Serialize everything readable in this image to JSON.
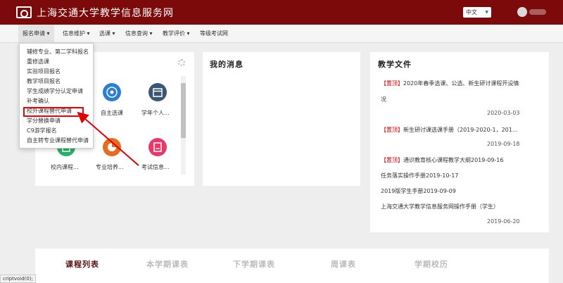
{
  "header": {
    "site_title": "上海交通大学教学信息服务网",
    "language": "中文",
    "language_icon": "chevron-down-icon",
    "brand_color": "#7d0a0a"
  },
  "nav": {
    "items": [
      {
        "label": "报名申请 ▾"
      },
      {
        "label": "信息维护 ▾"
      },
      {
        "label": "选课 ▾"
      },
      {
        "label": "信息查询 ▾"
      },
      {
        "label": "教学评价 ▾"
      },
      {
        "label": "等级考试网"
      }
    ]
  },
  "dropdown": {
    "items": [
      {
        "label": "辅修专业、第二学科报名"
      },
      {
        "label": "重修选课"
      },
      {
        "label": "实验项目报名"
      },
      {
        "label": "教学项目报名"
      },
      {
        "label": "学生成绩学分认定申请"
      },
      {
        "label": "补考确认"
      },
      {
        "label": "校外课程替代申请"
      },
      {
        "label": "学分替换申请"
      },
      {
        "label": "C9游学报名"
      },
      {
        "label": "自主转专业课程替代申请"
      }
    ],
    "highlighted_index": 6,
    "highlight_color": "#e00000"
  },
  "apps": {
    "items": [
      {
        "label": "自主选课",
        "icon": "soccer-ball-icon",
        "color": "#2a7fd4"
      },
      {
        "label": "学年个人...",
        "icon": "calendar-icon",
        "color": "#3a5672"
      },
      {
        "label": "校内课程...",
        "icon": "document-icon",
        "color": "#27b36a"
      },
      {
        "label": "专业培养...",
        "icon": "chart-icon",
        "color": "#e66d1f"
      },
      {
        "label": "考试信息...",
        "icon": "file-icon",
        "color": "#e83a6a"
      }
    ]
  },
  "messages": {
    "title": "我的消息"
  },
  "documents": {
    "title": "教学文件",
    "items": [
      {
        "tag": "【置顶】",
        "text": "2020年春季选课、公选、新生研讨课程开设情",
        "text2": "况",
        "date": "2020-03-03"
      },
      {
        "tag": "【置顶】",
        "text": "新生研讨课选课手册（2019-2020-1，201...",
        "date": "2019-09-18"
      },
      {
        "tag": "【置顶】",
        "text": "通识教育核心课程教学大纲2019-09-16",
        "date": ""
      },
      {
        "tag": "",
        "text": "任务落实操作手册2019-10-17",
        "date": ""
      },
      {
        "tag": "",
        "text": "2019版学生手册2019-09-09",
        "date": ""
      },
      {
        "tag": "",
        "text": "上海交通大学教学信息服务网操作手册（学生）",
        "date": "2019-06-20"
      }
    ]
  },
  "tabs": {
    "items": [
      {
        "label": "课程列表"
      },
      {
        "label": "本学期课表"
      },
      {
        "label": "下学期课表"
      },
      {
        "label": "周课表"
      },
      {
        "label": "学期校历"
      }
    ],
    "active_color": "#5c1010",
    "inactive_color": "#bbbbbb"
  },
  "status": {
    "text": "criptvoid(0);"
  },
  "annotation": {
    "arrow_color": "#e00000"
  }
}
